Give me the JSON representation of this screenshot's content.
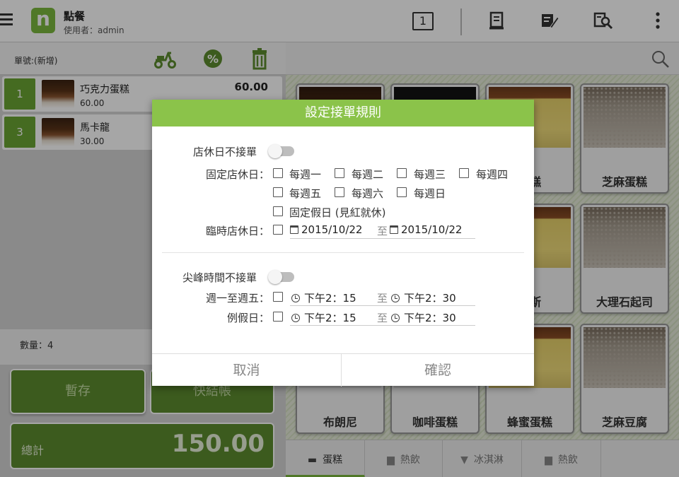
{
  "header": {
    "logo_letter": "n",
    "title": "點餐",
    "user": "使用者：admin",
    "table_number": "1",
    "icons": [
      "menu-icon",
      "receipt-icon",
      "edit-note-icon",
      "search-document-icon",
      "more-vert-icon"
    ]
  },
  "order": {
    "order_no": "單號:(新增)",
    "icons": [
      "delivery-scooter-icon",
      "discount-percent-icon",
      "trash-icon"
    ],
    "items": [
      {
        "qty": "1",
        "name": "巧克力蛋糕",
        "unit_price": "60.00",
        "total": "60.00"
      },
      {
        "qty": "3",
        "name": "馬卡龍",
        "unit_price": "30.00",
        "total": ""
      }
    ],
    "quantity_label": "數量：4",
    "save_button": "暫存",
    "checkout_button": "快結帳",
    "total_label": "總計",
    "total_value": "150.00"
  },
  "products": {
    "search_icon": "search-icon",
    "cards": [
      {
        "name": "",
        "pic": "choco"
      },
      {
        "name": "",
        "pic": "dark"
      },
      {
        "name": "蛋糕",
        "pic": "sponge"
      },
      {
        "name": "芝麻蛋糕",
        "pic": "sesame"
      },
      {
        "name": "",
        "pic": "none"
      },
      {
        "name": "",
        "pic": "none"
      },
      {
        "name": "慕斯",
        "pic": "sponge"
      },
      {
        "name": "大理石起司",
        "pic": "sesame"
      },
      {
        "name": "布朗尼",
        "pic": "none"
      },
      {
        "name": "咖啡蛋糕",
        "pic": "none"
      },
      {
        "name": "蜂蜜蛋糕",
        "pic": "sponge"
      },
      {
        "name": "芝麻豆腐",
        "pic": "sesame"
      }
    ],
    "tabs": [
      {
        "label": "蛋糕",
        "icon": "cake-icon",
        "active": true
      },
      {
        "label": "熱飲",
        "icon": "cup-icon",
        "active": false
      },
      {
        "label": "冰淇淋",
        "icon": "ice-cream-icon",
        "active": false
      },
      {
        "label": "熱飲",
        "icon": "cup-icon",
        "active": false
      }
    ]
  },
  "dialog": {
    "title": "設定接單規則",
    "closed_day_toggle_label": "店休日不接單",
    "fixed_closed_label": "固定店休日：",
    "weekdays": [
      "每週一",
      "每週二",
      "每週三",
      "每週四",
      "每週五",
      "每週六",
      "每週日"
    ],
    "holiday_option": "固定假日 (見紅就休)",
    "temp_closed_label": "臨時店休日：",
    "temp_from": "2015/10/22",
    "to_word": "至",
    "temp_to": "2015/10/22",
    "peak_toggle_label": "尖峰時間不接單",
    "weekday_range_label": "週一至週五：",
    "weekday_from": "下午2：15",
    "weekday_to": "下午2：30",
    "holiday_range_label": "例假日：",
    "holiday_from": "下午2：15",
    "holiday_to": "下午2：30",
    "cancel": "取消",
    "confirm": "確認"
  },
  "colors": {
    "accent": "#8bc34a",
    "dark_green": "#5d8c2e",
    "qty_green": "#6aa533"
  }
}
